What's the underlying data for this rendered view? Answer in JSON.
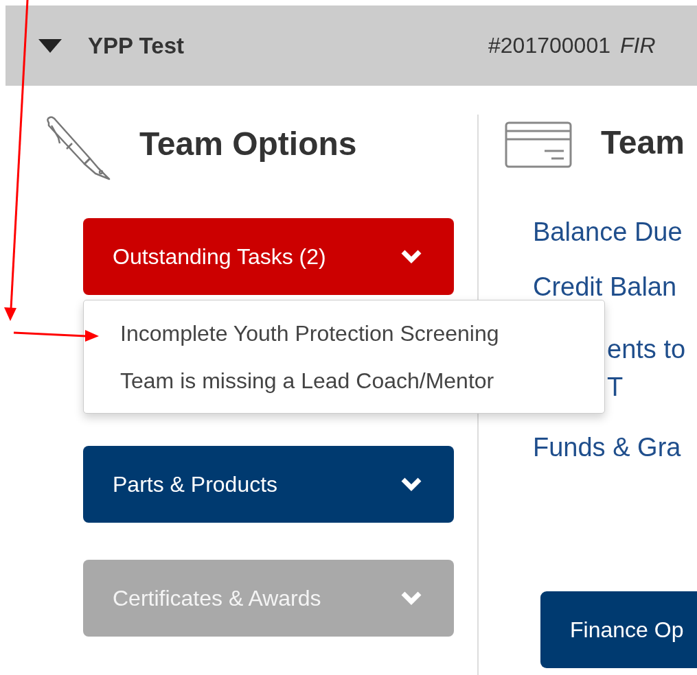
{
  "header": {
    "title": "YPP Test",
    "expanded": true,
    "number": "#201700001",
    "status": "FIR"
  },
  "team_options": {
    "title": "Team Options",
    "buttons": [
      {
        "label": "Outstanding Tasks (2)",
        "kind": "alert",
        "items": [
          "Incomplete Youth Protection Screening",
          "Team is missing a Lead Coach/Mentor"
        ]
      },
      {
        "label": "Parts & Products",
        "kind": "normal"
      },
      {
        "label": "Certificates & Awards",
        "kind": "disabled"
      }
    ]
  },
  "team_finance": {
    "title": "Team",
    "links": [
      {
        "lines": [
          "Balance Due"
        ]
      },
      {
        "lines": [
          "Credit Balan"
        ]
      },
      {
        "lines": [
          "ents to",
          "T"
        ]
      },
      {
        "lines": [
          "Funds & Gra"
        ]
      }
    ],
    "button": "Finance Op"
  }
}
